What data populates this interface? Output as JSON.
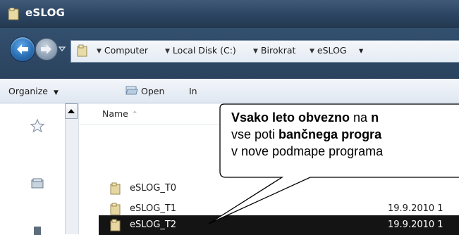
{
  "window": {
    "title": "eSLOG"
  },
  "address": {
    "crumbs": [
      "Computer",
      "Local Disk (C:)",
      "Birokrat",
      "eSLOG"
    ],
    "trailing_arrow": "▾"
  },
  "toolbar": {
    "organize_label": "Organize",
    "organize_caret": "▼",
    "open_label": "Open",
    "partial_label": "In"
  },
  "columns": {
    "name_label": "Name",
    "name_sort": "^"
  },
  "files": [
    {
      "name": "eSLOG_T0",
      "date": ""
    },
    {
      "name": "eSLOG_T1",
      "date": "19.9.2010 1"
    },
    {
      "name": "eSLOG_T2",
      "date": "19.9.2010 1",
      "selected": true
    }
  ],
  "callout": {
    "line1_bold": "Vsako leto obvezno",
    "line1_rest": " na ",
    "line1_tail_bold": "n",
    "line2_plain": "vse poti ",
    "line2_bold": "bančnega progra",
    "line3": "v nove podmape programa"
  },
  "colors": {
    "titlebar": "#2b4462",
    "selection": "#141414",
    "callout_border": "#000000"
  }
}
